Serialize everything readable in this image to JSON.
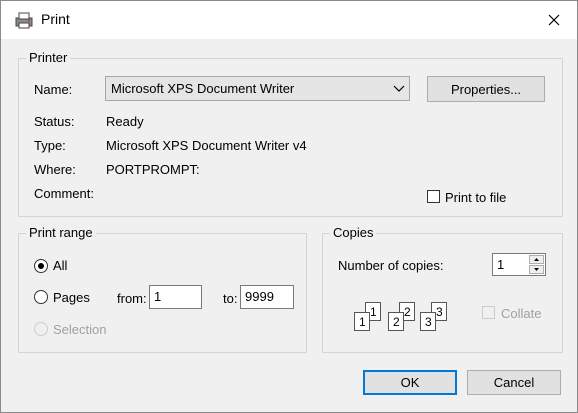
{
  "window": {
    "title": "Print"
  },
  "printer": {
    "legend": "Printer",
    "name_label": "Name:",
    "name_value": "Microsoft XPS Document Writer",
    "properties_button": "Properties...",
    "status_label": "Status:",
    "status_value": "Ready",
    "type_label": "Type:",
    "type_value": "Microsoft XPS Document Writer v4",
    "where_label": "Where:",
    "where_value": "PORTPROMPT:",
    "comment_label": "Comment:",
    "print_to_file_label": "Print to file",
    "print_to_file_checked": false
  },
  "print_range": {
    "legend": "Print range",
    "all_label": "All",
    "pages_label": "Pages",
    "from_label": "from:",
    "from_value": "1",
    "to_label": "to:",
    "to_value": "9999",
    "selection_label": "Selection",
    "selected": "All"
  },
  "copies": {
    "legend": "Copies",
    "number_label": "Number of copies:",
    "number_value": "1",
    "collate_label": "Collate",
    "collate_checked": false,
    "collate_pages": [
      "1",
      "1",
      "2",
      "2",
      "3",
      "3"
    ]
  },
  "buttons": {
    "ok": "OK",
    "cancel": "Cancel"
  },
  "colors": {
    "accent": "#0078d7",
    "titlebar": "#ffffff",
    "background": "#f0f0f0"
  }
}
